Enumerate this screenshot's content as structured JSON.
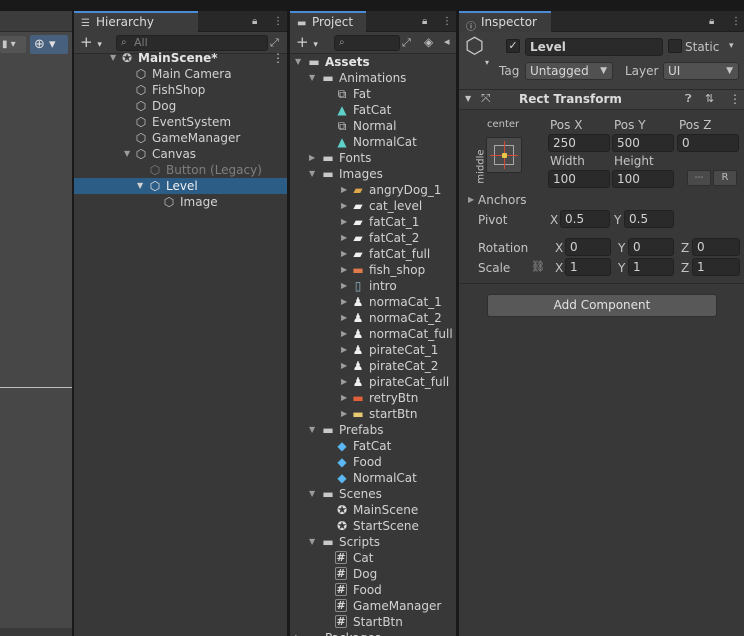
{
  "scene_view": {
    "toolbar_icons": [
      "grid-snap-icon",
      "gizmo-icon"
    ]
  },
  "hierarchy": {
    "tab_label": "Hierarchy",
    "search_placeholder": "All",
    "scene_name": "MainScene*",
    "items": [
      {
        "label": "Main Camera"
      },
      {
        "label": "FishShop"
      },
      {
        "label": "Dog"
      },
      {
        "label": "EventSystem"
      },
      {
        "label": "GameManager"
      },
      {
        "label": "Canvas"
      },
      {
        "label": "Button (Legacy)"
      },
      {
        "label": "Level"
      },
      {
        "label": "Image"
      }
    ]
  },
  "project": {
    "tab_label": "Project",
    "items": [
      {
        "label": "Assets"
      },
      {
        "label": "Animations"
      },
      {
        "label": "Fat"
      },
      {
        "label": "FatCat"
      },
      {
        "label": "Normal"
      },
      {
        "label": "NormalCat"
      },
      {
        "label": "Fonts"
      },
      {
        "label": "Images"
      },
      {
        "label": "angryDog_1"
      },
      {
        "label": "cat_level"
      },
      {
        "label": "fatCat_1"
      },
      {
        "label": "fatCat_2"
      },
      {
        "label": "fatCat_full"
      },
      {
        "label": "fish_shop"
      },
      {
        "label": "intro"
      },
      {
        "label": "normaCat_1"
      },
      {
        "label": "normaCat_2"
      },
      {
        "label": "normaCat_full"
      },
      {
        "label": "pirateCat_1"
      },
      {
        "label": "pirateCat_2"
      },
      {
        "label": "pirateCat_full"
      },
      {
        "label": "retryBtn"
      },
      {
        "label": "startBtn"
      },
      {
        "label": "Prefabs"
      },
      {
        "label": "FatCat"
      },
      {
        "label": "Food"
      },
      {
        "label": "NormalCat"
      },
      {
        "label": "Scenes"
      },
      {
        "label": "MainScene"
      },
      {
        "label": "StartScene"
      },
      {
        "label": "Scripts"
      },
      {
        "label": "Cat"
      },
      {
        "label": "Dog"
      },
      {
        "label": "Food"
      },
      {
        "label": "GameManager"
      },
      {
        "label": "StartBtn"
      },
      {
        "label": "Packages"
      }
    ]
  },
  "inspector": {
    "tab_label": "Inspector",
    "object_name": "Level",
    "static_label": "Static",
    "tag_label": "Tag",
    "tag_value": "Untagged",
    "layer_label": "Layer",
    "layer_value": "UI",
    "component_title": "Rect Transform",
    "anchor_h": "center",
    "anchor_v": "middle",
    "pos_x_label": "Pos X",
    "pos_y_label": "Pos Y",
    "pos_z_label": "Pos Z",
    "pos_x": "250",
    "pos_y": "500",
    "pos_z": "0",
    "width_label": "Width",
    "height_label": "Height",
    "width": "100",
    "height": "100",
    "r_label": "R",
    "anchors_label": "Anchors",
    "pivot_label": "Pivot",
    "pivot_x": "0.5",
    "pivot_y": "0.5",
    "rotation_label": "Rotation",
    "rot_x": "0",
    "rot_y": "0",
    "rot_z": "0",
    "scale_label": "Scale",
    "scale_x": "1",
    "scale_y": "1",
    "scale_z": "1",
    "x": "X",
    "y": "Y",
    "z": "Z",
    "add_component": "Add Component"
  }
}
